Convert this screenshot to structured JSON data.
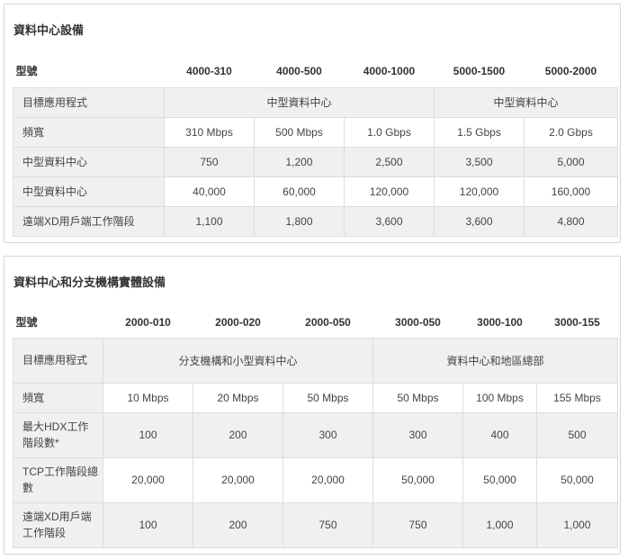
{
  "section1": {
    "title": "資料中心設備",
    "model_label": "型號",
    "models": [
      "4000-310",
      "4000-500",
      "4000-1000",
      "5000-1500",
      "5000-2000"
    ],
    "rows": [
      {
        "label": "目標應用程式",
        "groups": [
          "中型資料中心",
          "中型資料中心"
        ]
      },
      {
        "label": "頻寬",
        "values": [
          "310 Mbps",
          "500 Mbps",
          "1.0 Gbps",
          "1.5 Gbps",
          "2.0 Gbps"
        ]
      },
      {
        "label": "中型資料中心",
        "values": [
          "750",
          "1,200",
          "2,500",
          "3,500",
          "5,000"
        ]
      },
      {
        "label": "中型資料中心",
        "values": [
          "40,000",
          "60,000",
          "120,000",
          "120,000",
          "160,000"
        ]
      },
      {
        "label": "遠端XD用戶端工作階段",
        "values": [
          "1,100",
          "1,800",
          "3,600",
          "3,600",
          "4,800"
        ]
      }
    ]
  },
  "section2": {
    "title": "資料中心和分支機構實體設備",
    "model_label": "型號",
    "models": [
      "2000-010",
      "2000-020",
      "2000-050",
      "3000-050",
      "3000-100",
      "3000-155"
    ],
    "rows": [
      {
        "label": "目標應用程式",
        "groups": [
          "分支機構和小型資料中心",
          "資料中心和地區總部"
        ]
      },
      {
        "label": "頻寬",
        "values": [
          "10 Mbps",
          "20 Mbps",
          "50 Mbps",
          "50 Mbps",
          "100 Mbps",
          "155  Mbps"
        ]
      },
      {
        "label": "最大HDX工作階段數*",
        "values": [
          "100",
          "200",
          "300",
          "300",
          "400",
          "500"
        ]
      },
      {
        "label": "TCP工作階段總數",
        "values": [
          "20,000",
          "20,000",
          "20,000",
          "50,000",
          "50,000",
          "50,000"
        ]
      },
      {
        "label": "遠端XD用戶端工作階段",
        "values": [
          "100",
          "200",
          "750",
          "750",
          "1,000",
          "1,000"
        ]
      }
    ]
  }
}
